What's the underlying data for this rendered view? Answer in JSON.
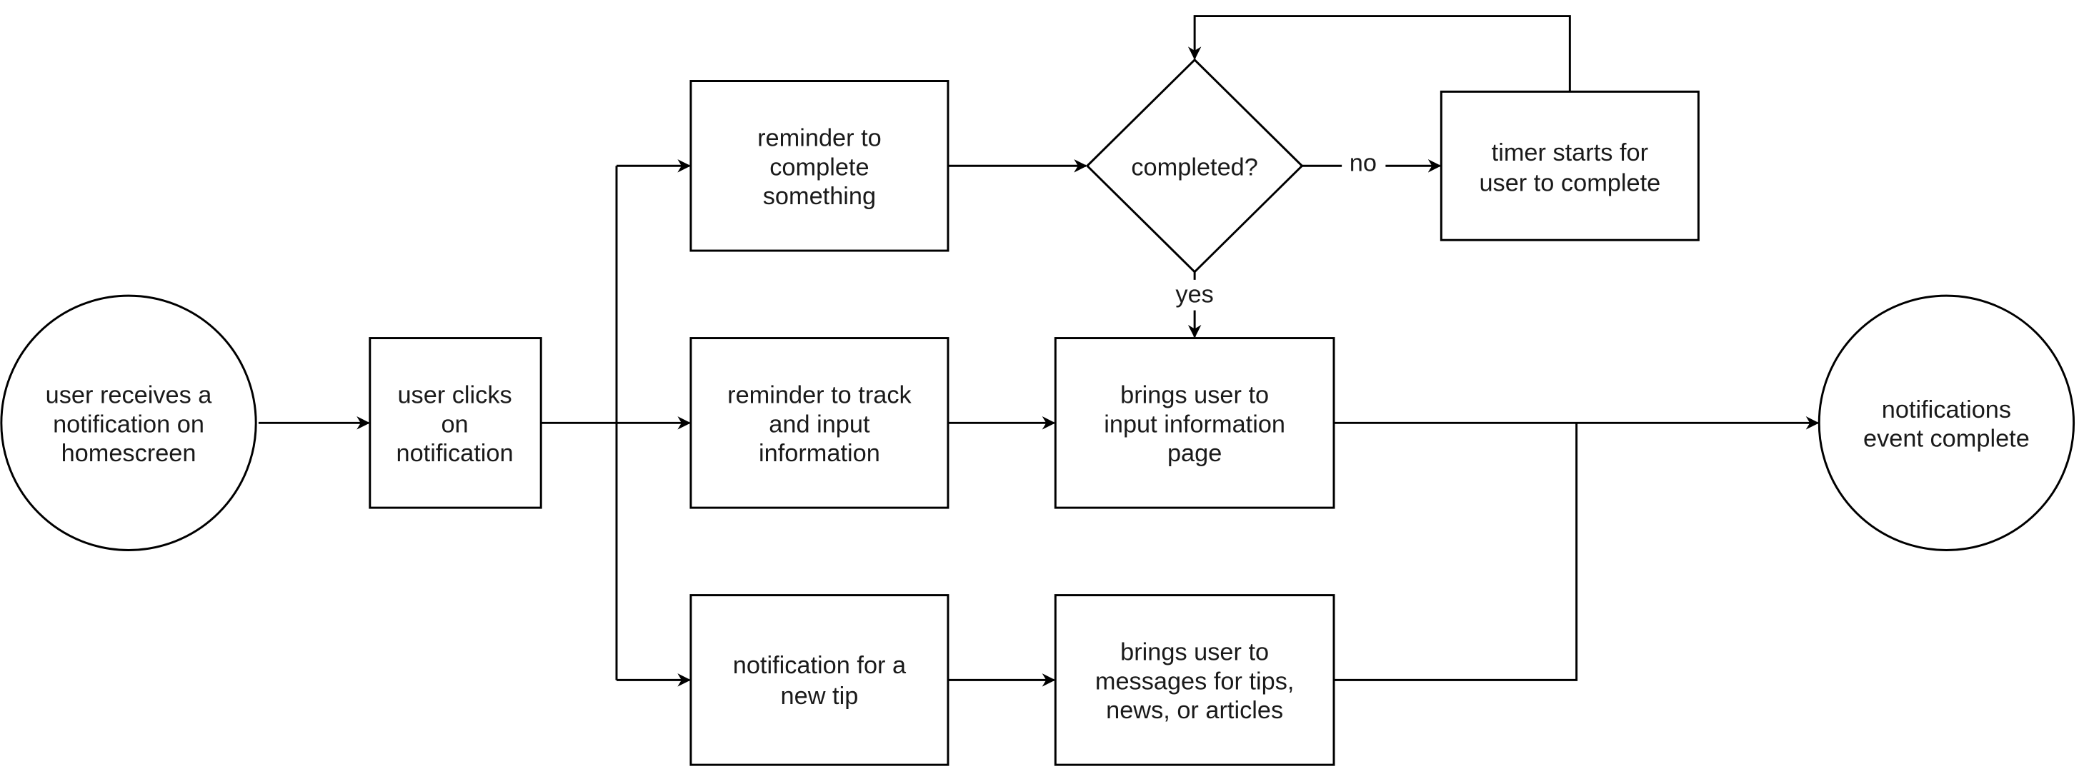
{
  "nodes": {
    "start": [
      "user receives a",
      "notification on",
      "homescreen"
    ],
    "click": [
      "user clicks",
      "on",
      "notification"
    ],
    "reminder_complete": [
      "reminder to",
      "complete",
      "something"
    ],
    "reminder_track": [
      "reminder to track",
      "and input",
      "information"
    ],
    "new_tip": [
      "notification for a",
      "new tip"
    ],
    "completed": [
      "completed?"
    ],
    "timer": [
      "timer starts for",
      "user to complete"
    ],
    "input_page": [
      "brings user to",
      "input information",
      "page"
    ],
    "messages": [
      "brings user to",
      "messages for tips,",
      "news, or articles"
    ],
    "end": [
      "notifications",
      "event complete"
    ]
  },
  "edge_labels": {
    "no": "no",
    "yes": "yes"
  },
  "colors": {
    "stroke": "#000000",
    "fill": "#ffffff"
  }
}
